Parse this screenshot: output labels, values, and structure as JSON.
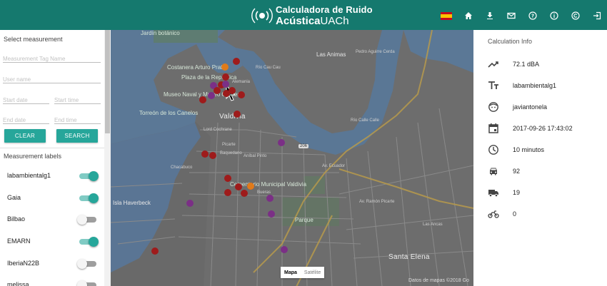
{
  "header": {
    "logo_line1": "Calculadora de Ruido",
    "logo_line2_bold": "Acústica",
    "logo_line2_rest": "UACh",
    "nav_icons": [
      "spain-flag-icon",
      "home-icon",
      "download-icon",
      "mail-icon",
      "help-icon",
      "info-icon",
      "copyright-icon",
      "login-icon"
    ]
  },
  "filters": {
    "title": "Select measurement",
    "tag_placeholder": "Measurement Tag Name",
    "user_placeholder": "User name",
    "start_date_placeholder": "Start date",
    "start_time_placeholder": "Start time",
    "end_date_placeholder": "End date",
    "end_time_placeholder": "End time",
    "clear_label": "CLEAR",
    "search_label": "SEARCH"
  },
  "labels": {
    "title": "Measurement labels",
    "items": [
      {
        "name": "labambientalg1",
        "enabled": true
      },
      {
        "name": "Gaia",
        "enabled": true
      },
      {
        "name": "Bilbao",
        "enabled": false
      },
      {
        "name": "EMARN",
        "enabled": true
      },
      {
        "name": "IberiaN22B",
        "enabled": false
      },
      {
        "name": "melissa",
        "enabled": false
      }
    ]
  },
  "map": {
    "labels": {
      "jardin": "Jardín botánico",
      "costanera": "Costanera Arturo Prat",
      "plaza": "Plaza de la República",
      "museo": "Museo Naval y Museo O'Brien",
      "torreon": "Torreón de los Canelos",
      "valdivia": "Valdivia",
      "las_animas": "Las Animas",
      "cementerio": "Cementerio Municipal Valdivia",
      "parque": "Parque",
      "isla_haverbeck": "Isla Haverbeck",
      "santa_elena": "Santa Elena",
      "las_ancas": "Las Ancas",
      "rio_cau_cau": "Río Cau Cau",
      "rio_calle_calle": "Río Calle Calle",
      "pedro_aguirre": "Pedro Aguirre Cerda",
      "av_ramon": "Av. Ramón Picarte",
      "av_ecuador": "Av. Ecuador",
      "picarte": "Picarte",
      "baquedano": "Baquedano",
      "anibal_pinto": "Aníbal Pinto",
      "lord_cochrane": "Lord Cochrane",
      "bueras": "Bueras",
      "chacabuco": "Chacabuco",
      "route_206": "206",
      "alemania": "Alemania",
      "mapa_tab": "Mapa",
      "satelite_tab": "Satélite",
      "attribution": "Datos de mapas ©2018 Go"
    },
    "marker_colors": {
      "red": "#9e1b1b",
      "purple": "#7b2f86",
      "orange": "#e07b1a"
    }
  },
  "calculation": {
    "title": "Calculation Info",
    "rows": [
      {
        "icon": "trending-up-icon",
        "value": "72.1 dBA"
      },
      {
        "icon": "text-size-icon",
        "value": "labambientalg1"
      },
      {
        "icon": "face-icon",
        "value": "javiantonela"
      },
      {
        "icon": "calendar-icon",
        "value": "2017-09-26 17:43:02"
      },
      {
        "icon": "clock-icon",
        "value": "10 minutos"
      },
      {
        "icon": "car-icon",
        "value": "92"
      },
      {
        "icon": "truck-icon",
        "value": "19"
      },
      {
        "icon": "motorcycle-icon",
        "value": "0"
      }
    ]
  }
}
